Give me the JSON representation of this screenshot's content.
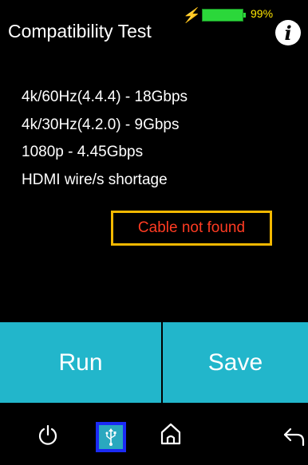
{
  "status": {
    "battery_percent": "99%",
    "battery_level": 0.99,
    "charging_icon": "bolt-icon"
  },
  "header": {
    "title": "Compatibility Test",
    "info_icon": "i"
  },
  "results": {
    "lines": [
      "4k/60Hz(4.4.4) - 18Gbps",
      "4k/30Hz(4.2.0) - 9Gbps",
      "1080p - 4.45Gbps",
      "HDMI wire/s shortage"
    ],
    "alert": "Cable not found"
  },
  "actions": {
    "run_label": "Run",
    "save_label": "Save"
  },
  "nav": {
    "items": [
      "power-icon",
      "usb-icon",
      "home-icon",
      "back-icon"
    ]
  },
  "colors": {
    "background": "#000000",
    "accent_button": "#22b6cb",
    "alert_border": "#f3b800",
    "alert_text": "#ff3b22",
    "battery": "#2bd73a",
    "usb_highlight": "#1b2bf5"
  }
}
